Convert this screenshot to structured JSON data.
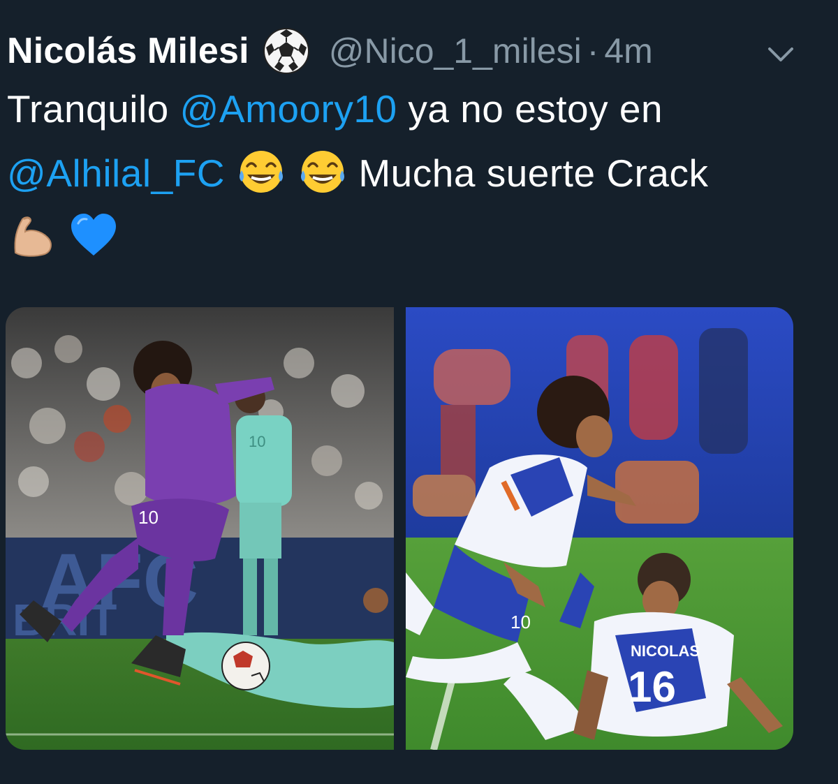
{
  "tweet": {
    "display_name": "Nicolás Milesi",
    "handle": "@Nico_1_milesi",
    "separator": "·",
    "time": "4m",
    "text": {
      "line1_prefix": "Tranquilo",
      "mention1": "@Amoory10",
      "line1_suffix": "ya no estoy en",
      "mention2": "@Alhilal_FC",
      "line2_suffix": "Mucha suerte Crack"
    },
    "emojis": [
      "soccer-ball",
      "tears-of-joy",
      "tears-of-joy",
      "flexed-biceps",
      "blue-heart"
    ]
  },
  "media": {
    "left_photo": {
      "banner_text": "AFC",
      "banner_text2": "BRIT",
      "player_number": "10",
      "opponent_number": "10"
    },
    "right_photo": {
      "jersey_name": "NICOLAS",
      "jersey_number": "16",
      "player_number": "10"
    }
  },
  "colors": {
    "background": "#15202b",
    "mention": "#1da1f2",
    "muted": "#8899a6"
  }
}
